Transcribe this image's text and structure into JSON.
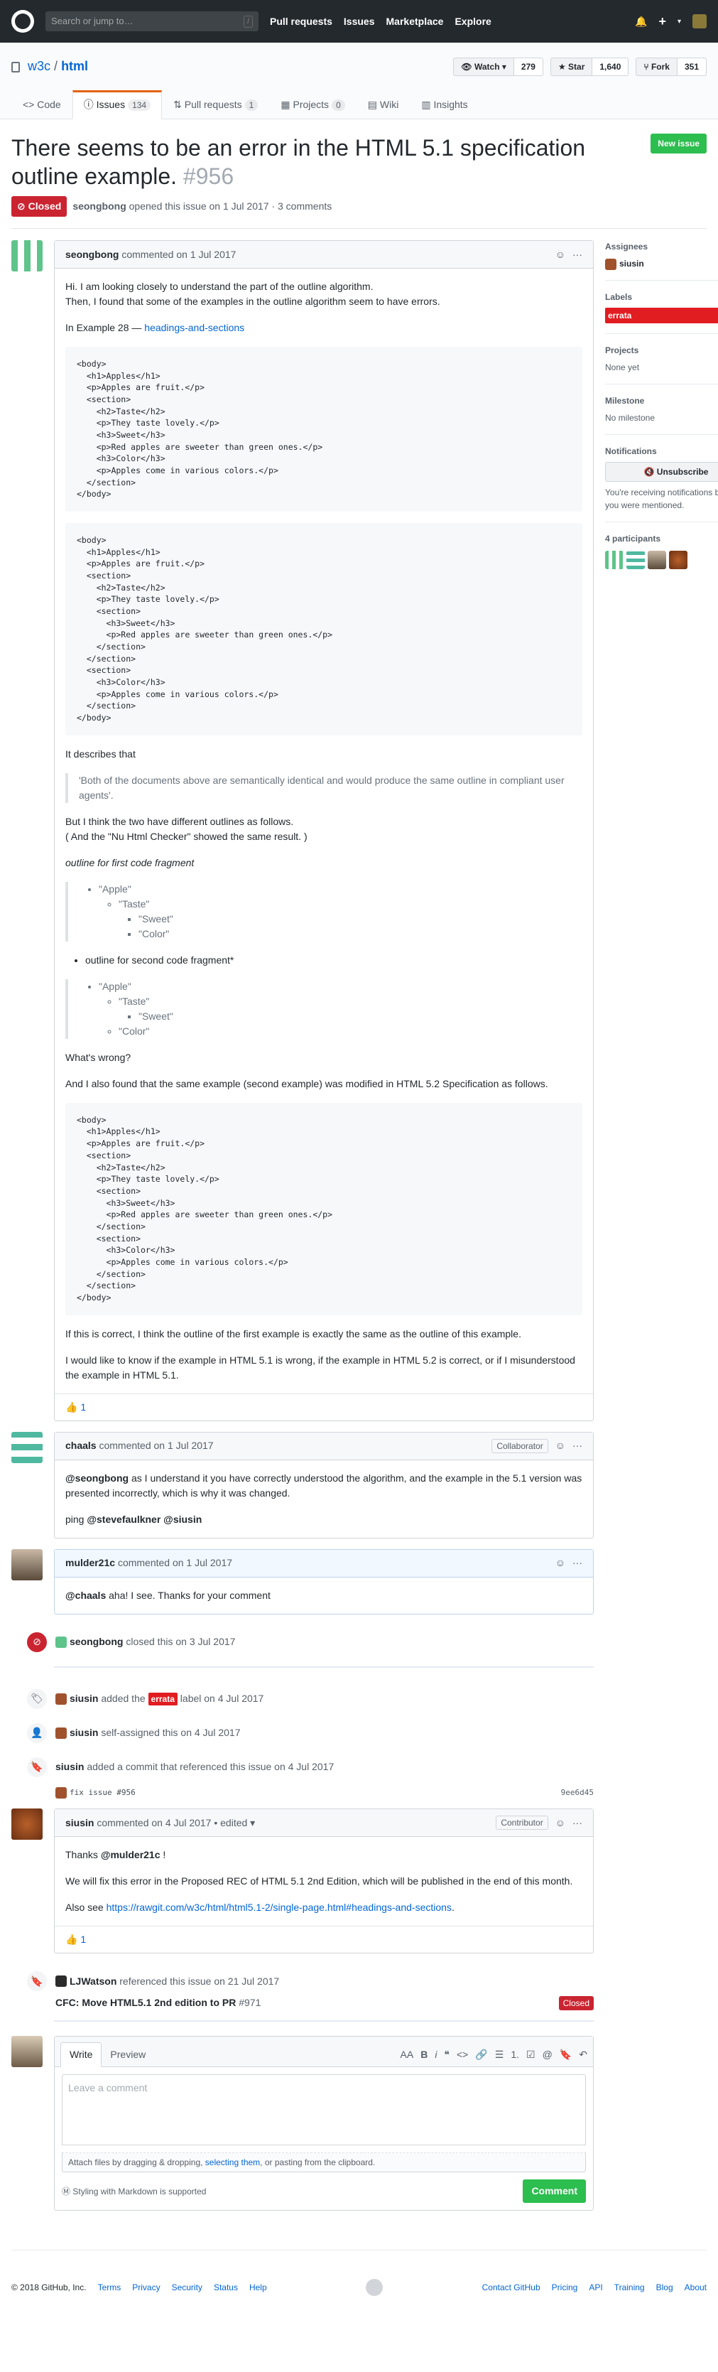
{
  "header": {
    "search_placeholder": "Search or jump to…",
    "slash": "/",
    "nav": [
      "Pull requests",
      "Issues",
      "Marketplace",
      "Explore"
    ],
    "plus": "+"
  },
  "repo": {
    "owner": "w3c",
    "name": "html",
    "watch_label": "Watch",
    "watch_count": "279",
    "star_label": "Star",
    "star_count": "1,640",
    "fork_label": "Fork",
    "fork_count": "351",
    "tabs": [
      {
        "label": "Code",
        "count": ""
      },
      {
        "label": "Issues",
        "count": "134"
      },
      {
        "label": "Pull requests",
        "count": "1"
      },
      {
        "label": "Projects",
        "count": "0"
      },
      {
        "label": "Wiki",
        "count": ""
      },
      {
        "label": "Insights",
        "count": ""
      }
    ]
  },
  "issue": {
    "title": "There seems to be an error in the HTML 5.1 specification outline example.",
    "number": "#956",
    "new_issue": "New issue",
    "state": "Closed",
    "author": "seongbong",
    "meta": "opened this issue on 1 Jul 2017 · 3 comments"
  },
  "comment1": {
    "author": "seongbong",
    "when": "commented on 1 Jul 2017",
    "p1": "Hi. I am looking closely to understand the part of the outline algorithm.",
    "p2": "Then, I found that some of the examples in the outline algorithm seem to have errors.",
    "p3_pre": "In Example 28 — ",
    "p3_link": "headings-and-sections",
    "code1": "<body>\n  <h1>Apples</h1>\n  <p>Apples are fruit.</p>\n  <section>\n    <h2>Taste</h2>\n    <p>They taste lovely.</p>\n    <h3>Sweet</h3>\n    <p>Red apples are sweeter than green ones.</p>\n    <h3>Color</h3>\n    <p>Apples come in various colors.</p>\n  </section>\n</body>",
    "code2": "<body>\n  <h1>Apples</h1>\n  <p>Apples are fruit.</p>\n  <section>\n    <h2>Taste</h2>\n    <p>They taste lovely.</p>\n    <section>\n      <h3>Sweet</h3>\n      <p>Red apples are sweeter than green ones.</p>\n    </section>\n  </section>\n  <section>\n    <h3>Color</h3>\n    <p>Apples come in various colors.</p>\n  </section>\n</body>",
    "p4": "It describes that",
    "quote1": "'Both of the documents above are semantically identical and would produce the same outline in compliant user agents'.",
    "p5a": "But I think the two have different outlines as follows.",
    "p5b": "( And the \"Nu Html Checker\" showed the same result. )",
    "outline1_title": "outline for first code fragment",
    "o_apple": "\"Apple\"",
    "o_taste": "\"Taste\"",
    "o_sweet": "\"Sweet\"",
    "o_color": "\"Color\"",
    "outline2_title": "outline for second code fragment*",
    "p6": "What's wrong?",
    "p7": "And I also found that the same example (second example) was modified in HTML 5.2 Specification as follows.",
    "code3": "<body>\n  <h1>Apples</h1>\n  <p>Apples are fruit.</p>\n  <section>\n    <h2>Taste</h2>\n    <p>They taste lovely.</p>\n    <section>\n      <h3>Sweet</h3>\n      <p>Red apples are sweeter than green ones.</p>\n    </section>\n    <section>\n      <h3>Color</h3>\n      <p>Apples come in various colors.</p>\n    </section>\n  </section>\n</body>",
    "p8": "If this is correct, I think the outline of the first example is exactly the same as the outline of this example.",
    "p9": "I would like to know if the example in HTML 5.1 is wrong, if the example in HTML 5.2 is correct, or if I misunderstood the example in HTML 5.1.",
    "reaction": "👍",
    "reaction_count": "1"
  },
  "comment2": {
    "author": "chaals",
    "when": "commented on 1 Jul 2017",
    "role": "Collaborator",
    "mention": "@seongbong",
    "text": " as I understand it you have correctly understood the algorithm, and the example in the 5.1 version was presented incorrectly, which is why it was changed.",
    "ping": "ping ",
    "ping_users": "@stevefaulkner @siusin"
  },
  "comment3": {
    "author": "mulder21c",
    "when": "commented on 1 Jul 2017",
    "mention": "@chaals",
    "text": " aha! I see. Thanks for your comment"
  },
  "events": {
    "closed_user": "seongbong",
    "closed_text": "closed this on 3 Jul 2017",
    "label_user": "siusin",
    "label_pre": "added the",
    "label_name": "errata",
    "label_post": "label on 4 Jul 2017",
    "assign_user": "siusin",
    "assign_text": "self-assigned this on 4 Jul 2017",
    "commit_user": "siusin",
    "commit_text": "added a commit that referenced this issue on 4 Jul 2017",
    "commit_msg": "fix issue #956",
    "commit_sha": "9ee6d45"
  },
  "comment4": {
    "author": "siusin",
    "when": "commented on 4 Jul 2017 • edited ▾",
    "role": "Contributor",
    "thanks": "Thanks ",
    "thanks_user": "@mulder21c",
    "thanks_end": " !",
    "p2": "We will fix this error in the Proposed REC of HTML 5.1 2nd Edition, which will be published in the end of this month.",
    "p3_pre": "Also see ",
    "p3_link": "https://rawgit.com/w3c/html/html5.1-2/single-page.html#headings-and-sections",
    "p3_end": ".",
    "reaction": "👍",
    "reaction_count": "1"
  },
  "reference": {
    "user": "LJWatson",
    "text": "referenced this issue on 21 Jul 2017",
    "pr_title": "CFC: Move HTML5.1 2nd edition to PR",
    "pr_num": "#971",
    "pr_state": "Closed"
  },
  "new_comment": {
    "tab_write": "Write",
    "tab_preview": "Preview",
    "placeholder": "Leave a comment",
    "drop_pre": "Attach files by dragging & dropping, ",
    "drop_link": "selecting them",
    "drop_post": ", or pasting from the clipboard.",
    "markdown": "Styling with Markdown is supported",
    "submit": "Comment",
    "toolbar": [
      "AA",
      "B",
      "i",
      "❝",
      "<>",
      "🔗",
      "☰",
      "1.",
      "☑",
      "@",
      "🔖",
      "↶"
    ]
  },
  "sidebar": {
    "assignees_head": "Assignees",
    "assignee": "siusin",
    "labels_head": "Labels",
    "label": "errata",
    "projects_head": "Projects",
    "projects_val": "None yet",
    "milestone_head": "Milestone",
    "milestone_val": "No milestone",
    "notif_head": "Notifications",
    "unsubscribe": "Unsubscribe",
    "notif_note": "You're receiving notifications because you were mentioned.",
    "participants_head": "4 participants"
  },
  "footer": {
    "copyright": "© 2018 GitHub, Inc.",
    "left_links": [
      "Terms",
      "Privacy",
      "Security",
      "Status",
      "Help"
    ],
    "right_links": [
      "Contact GitHub",
      "Pricing",
      "API",
      "Training",
      "Blog",
      "About"
    ]
  },
  "colors": {
    "accent": "#0366d6",
    "closed": "#cb2431",
    "green": "#2cbe4e",
    "errata": "#e11d21"
  }
}
